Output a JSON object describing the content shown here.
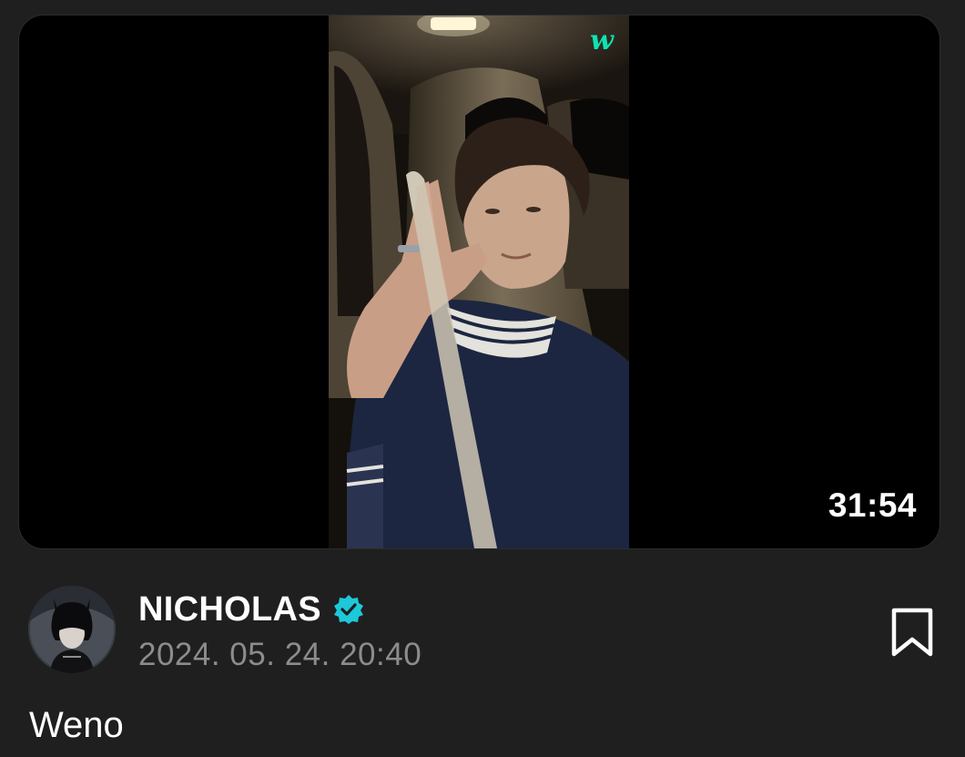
{
  "video": {
    "watermark": "w",
    "duration": "31:54"
  },
  "author": {
    "name": "NICHOLAS",
    "date": "2024. 05. 24. 20:40",
    "verified": true
  },
  "post": {
    "text": "Weno"
  },
  "colors": {
    "accent": "#0fe3b0",
    "verified_badge": "#1ec8d8",
    "background": "#1f1f1f",
    "muted_text": "#8c8c8c"
  },
  "icons": {
    "verified": "verified-badge-icon",
    "bookmark": "bookmark-icon"
  }
}
